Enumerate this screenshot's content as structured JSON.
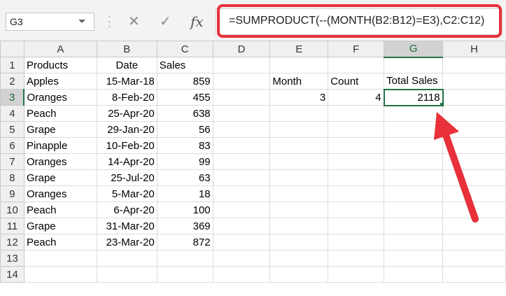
{
  "name_box": {
    "value": "G3"
  },
  "formula_bar": {
    "cancel_icon": "x-icon",
    "enter_icon": "check-icon",
    "fx_label": "fx",
    "formula": "=SUMPRODUCT(--(MONTH(B2:B12)=E3),C2:C12)"
  },
  "columns": [
    "A",
    "B",
    "C",
    "D",
    "E",
    "F",
    "G",
    "H"
  ],
  "rows": [
    "1",
    "2",
    "3",
    "4",
    "5",
    "6",
    "7",
    "8",
    "9",
    "10",
    "11",
    "12",
    "13",
    "14"
  ],
  "cells": {
    "A1": "Products",
    "B1": "Date",
    "C1": "Sales",
    "A2": "Apples",
    "B2": "15-Mar-18",
    "C2": "859",
    "A3": "Oranges",
    "B3": "8-Feb-20",
    "C3": "455",
    "A4": "Peach",
    "B4": "25-Apr-20",
    "C4": "638",
    "A5": "Grape",
    "B5": "29-Jan-20",
    "C5": "56",
    "A6": "Pinapple",
    "B6": "10-Feb-20",
    "C6": "83",
    "A7": "Oranges",
    "B7": "14-Apr-20",
    "C7": "99",
    "A8": "Grape",
    "B8": "25-Jul-20",
    "C8": "63",
    "A9": "Oranges",
    "B9": "5-Mar-20",
    "C9": "18",
    "A10": "Peach",
    "B10": "6-Apr-20",
    "C10": "100",
    "A11": "Grape",
    "B11": "31-Mar-20",
    "C11": "369",
    "A12": "Peach",
    "B12": "23-Mar-20",
    "C12": "872",
    "E2": "Month",
    "F2": "Count",
    "G2": "Total Sales",
    "E3": "3",
    "F3": "4",
    "G3": "2118"
  },
  "active_cell": "G3",
  "colors": {
    "highlight": "#e8313a",
    "selection": "#217346"
  }
}
